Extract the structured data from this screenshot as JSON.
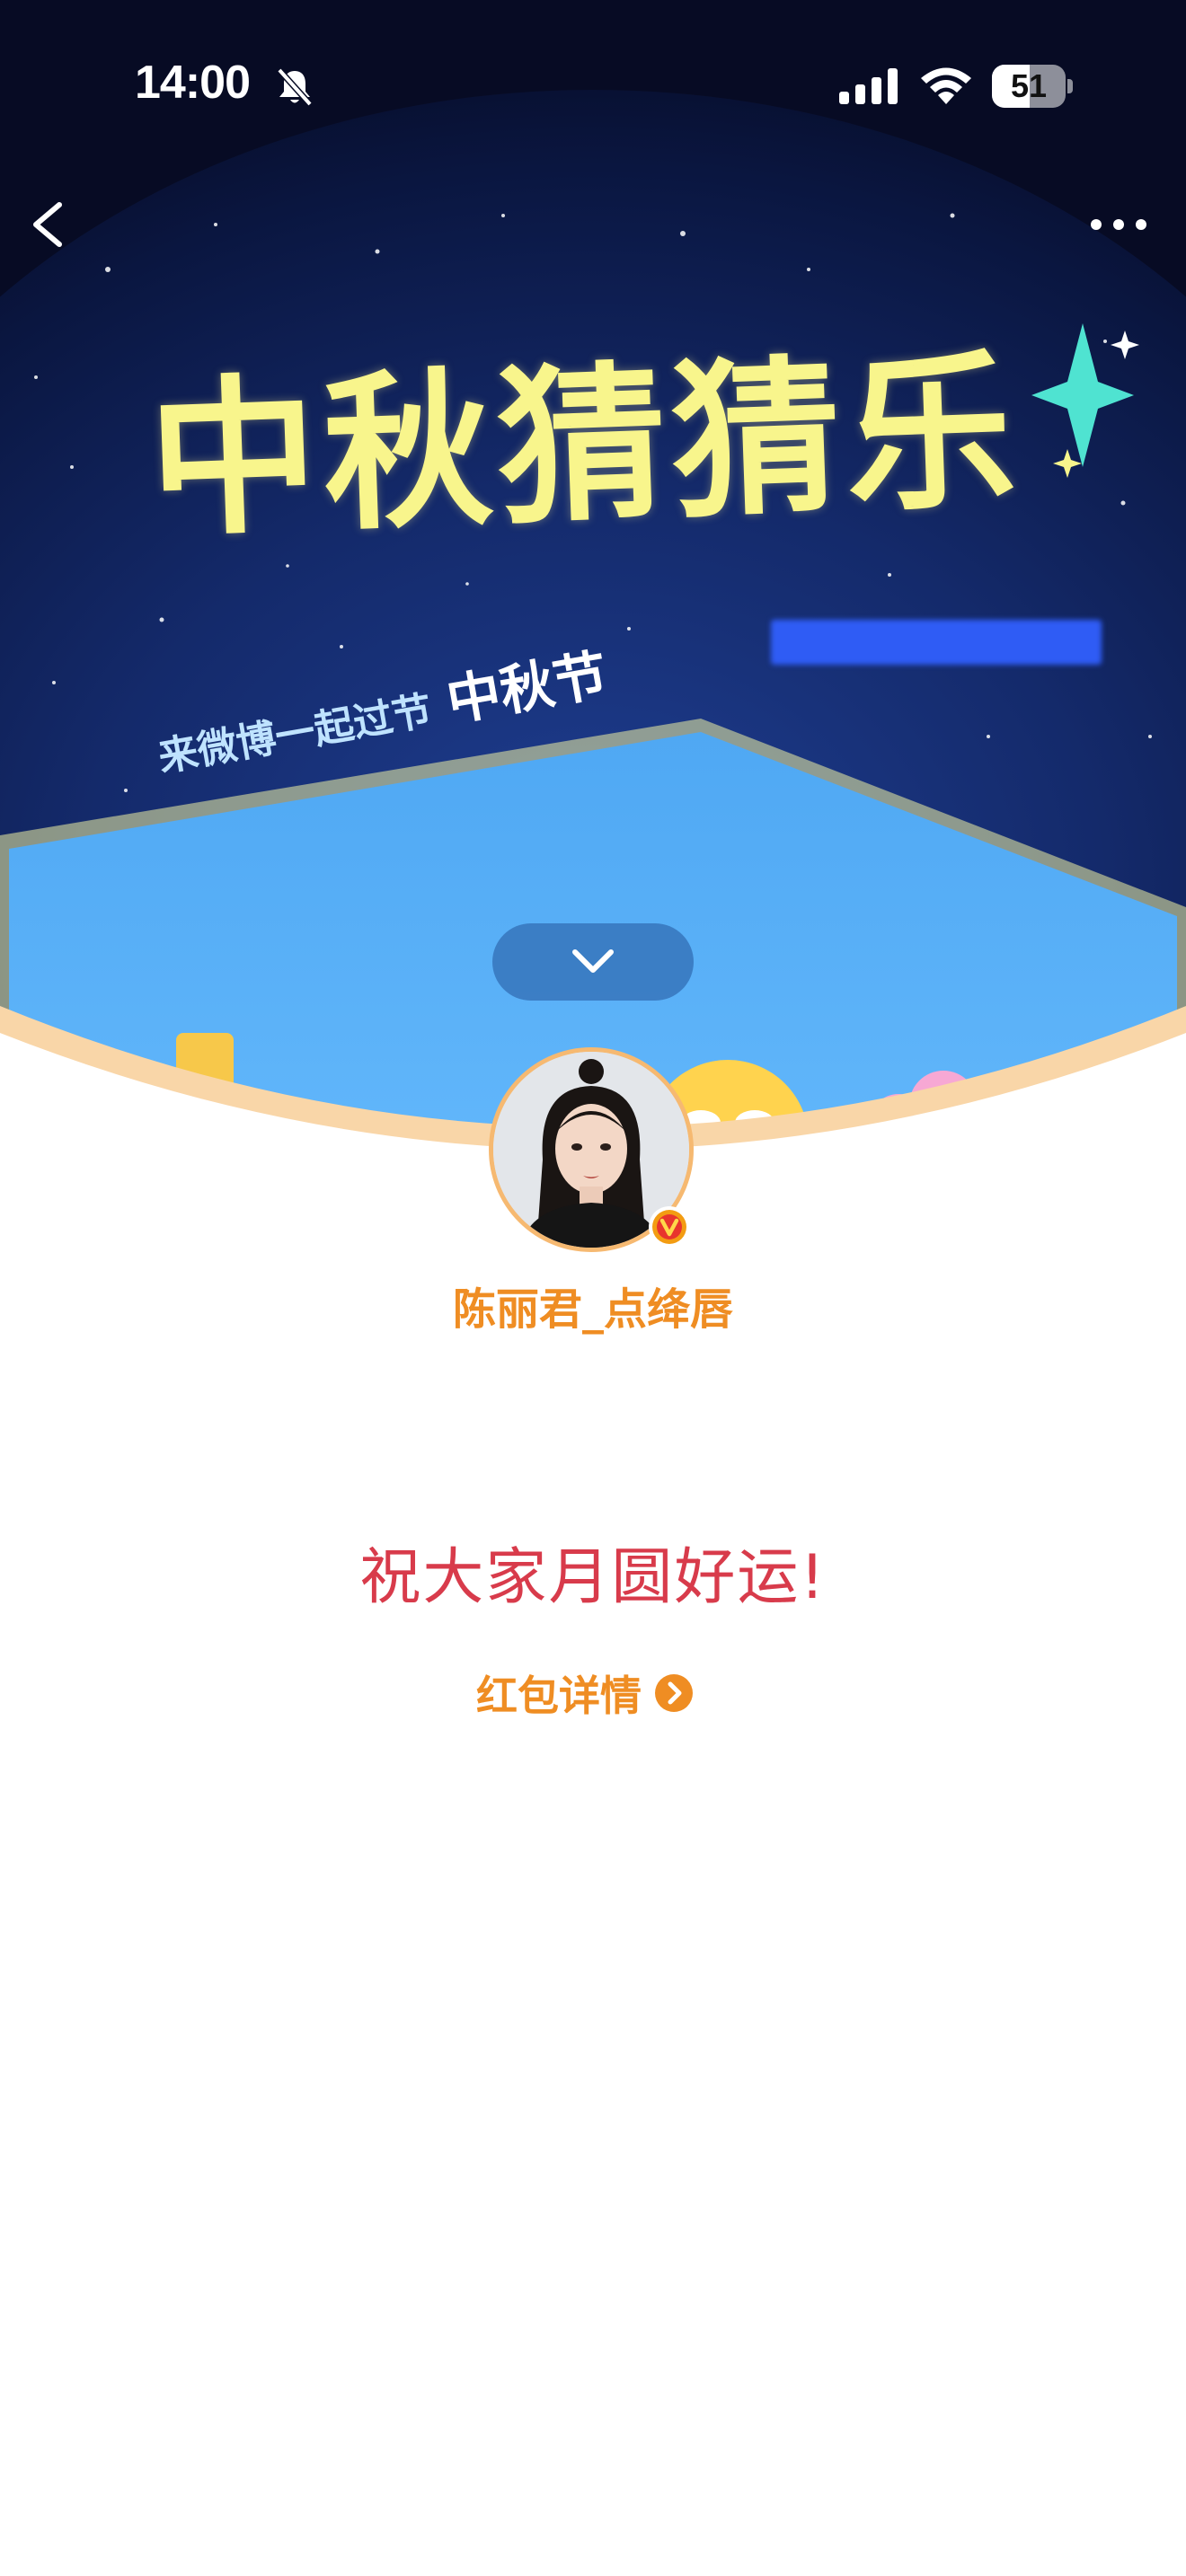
{
  "status_bar": {
    "time": "14:00",
    "battery_level": "51",
    "icons": [
      "bell-muted-icon",
      "signal-icon",
      "wifi-icon",
      "battery-icon"
    ]
  },
  "navigation": {
    "back_icon": "chevron-left-icon",
    "more_icon": "more-dots-icon"
  },
  "banner": {
    "title": "中秋猜猜乐",
    "subtitle_prefix": "来微博一起过节",
    "subtitle_tag": "中秋节"
  },
  "expand_toggle": {
    "icon": "chevron-down-icon"
  },
  "sender": {
    "name": "陈丽君_点绛唇",
    "badge_icon": "verified-v-icon"
  },
  "message": {
    "greeting": "祝大家月圆好运!"
  },
  "details_link": {
    "label": "红包详情",
    "icon": "chevron-right-circle-icon"
  },
  "colors": {
    "accent_orange": "#ef8d23",
    "greeting_red": "#d83b4b",
    "banner_title_yellow": "#f8f58c",
    "banner_sky": "#0b1a4a",
    "card_blue": "#5bb2f6",
    "rim_peach": "#f9d6a8"
  }
}
